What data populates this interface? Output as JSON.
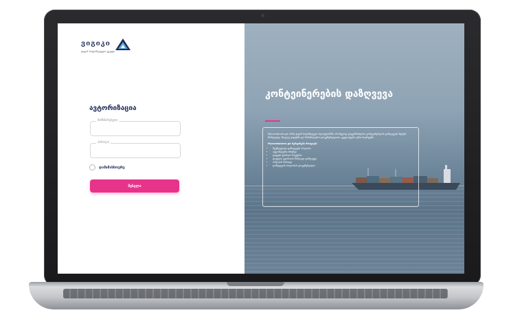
{
  "brand": {
    "name": "ვიგიკი",
    "tagline": "ვიგის სადაზღვევო ჯგუფი",
    "colors": {
      "navy": "#1f2a55",
      "accent": "#e8338b"
    }
  },
  "login": {
    "title": "ავტორიზაცია",
    "username_label": "მომხმარებელი",
    "username_value": "",
    "password_label": "პაროლი",
    "password_value": "",
    "remember_label": "დამიმახსოვრე",
    "submit_label": "შესვლა"
  },
  "hero": {
    "title": "კონტეინერების დაზღვევა",
    "description": "Mycontainers.ge არის ვიგის სადაზღვევო პლატფორმა, რომელიც დაგეხმარებათ კონტეინერების დაზღვევის შეძენა მარტივად, მოკლე ვადებში და მინიმალური დოკუმენტაციით, ყველაფერი ერთ სივრცეში.",
    "offers_title": "Mycontainers.ge სერვისები მოიცავს:",
    "offers": [
      "შეუზღუდავი დაზღვევის პოლისი",
      "ავტომატური ბრუნვა",
      "დაცვის ფართო სპექტრი",
      "ყოველი ტვირთის მარტივი დაზღვევა",
      "ონლაინ მართვა",
      "დაზღვევის პოლისის დოკუმენტაცია"
    ]
  }
}
